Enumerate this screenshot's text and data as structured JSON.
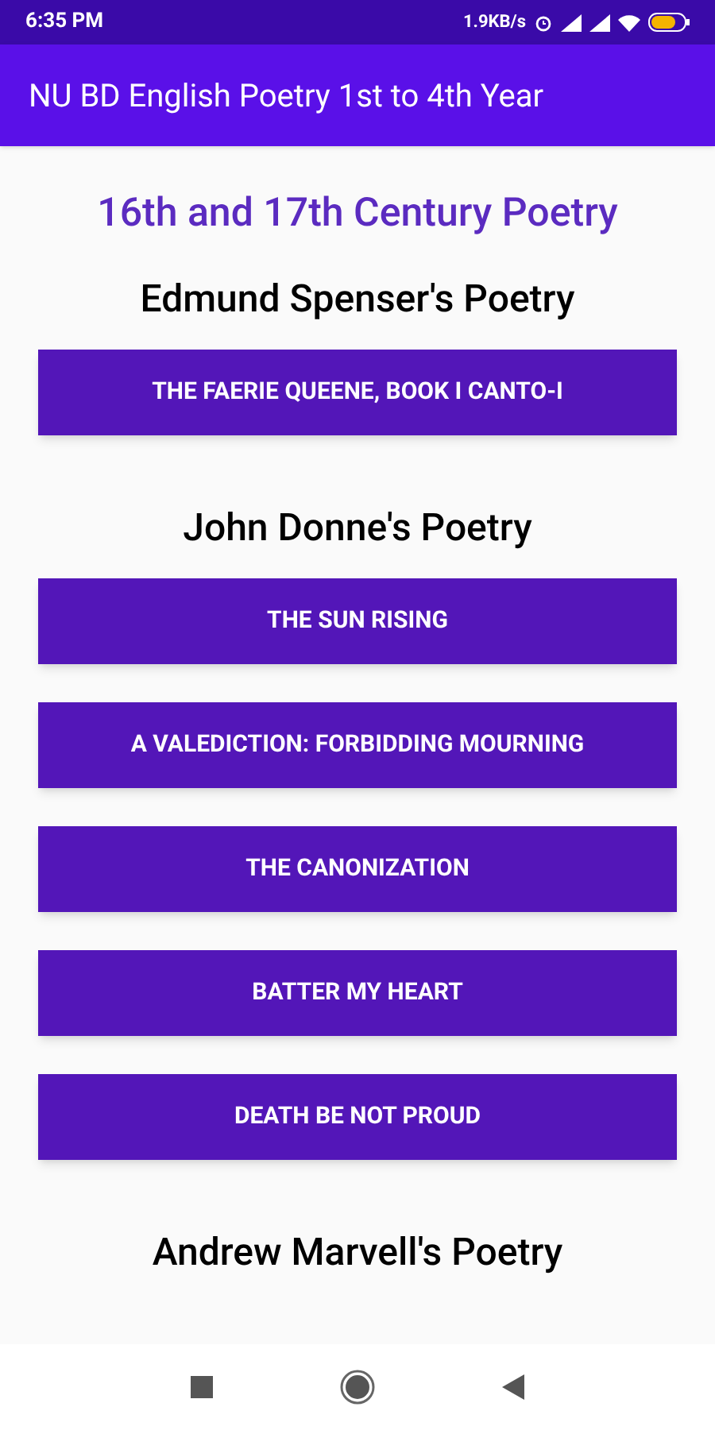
{
  "status_bar": {
    "time": "6:35 PM",
    "speed": "1.9KB/s"
  },
  "app_bar": {
    "title": "NU BD English Poetry 1st to 4th Year"
  },
  "page_title": "16th and 17th Century Poetry",
  "sections": [
    {
      "title": "Edmund Spenser's Poetry",
      "buttons": [
        "THE FAERIE QUEENE, BOOK I CANTO-I"
      ]
    },
    {
      "title": "John Donne's Poetry",
      "buttons": [
        "THE SUN RISING",
        "A VALEDICTION: FORBIDDING MOURNING",
        "THE CANONIZATION",
        "BATTER MY HEART",
        "DEATH BE NOT PROUD"
      ]
    },
    {
      "title": "Andrew Marvell's Poetry"
    }
  ]
}
